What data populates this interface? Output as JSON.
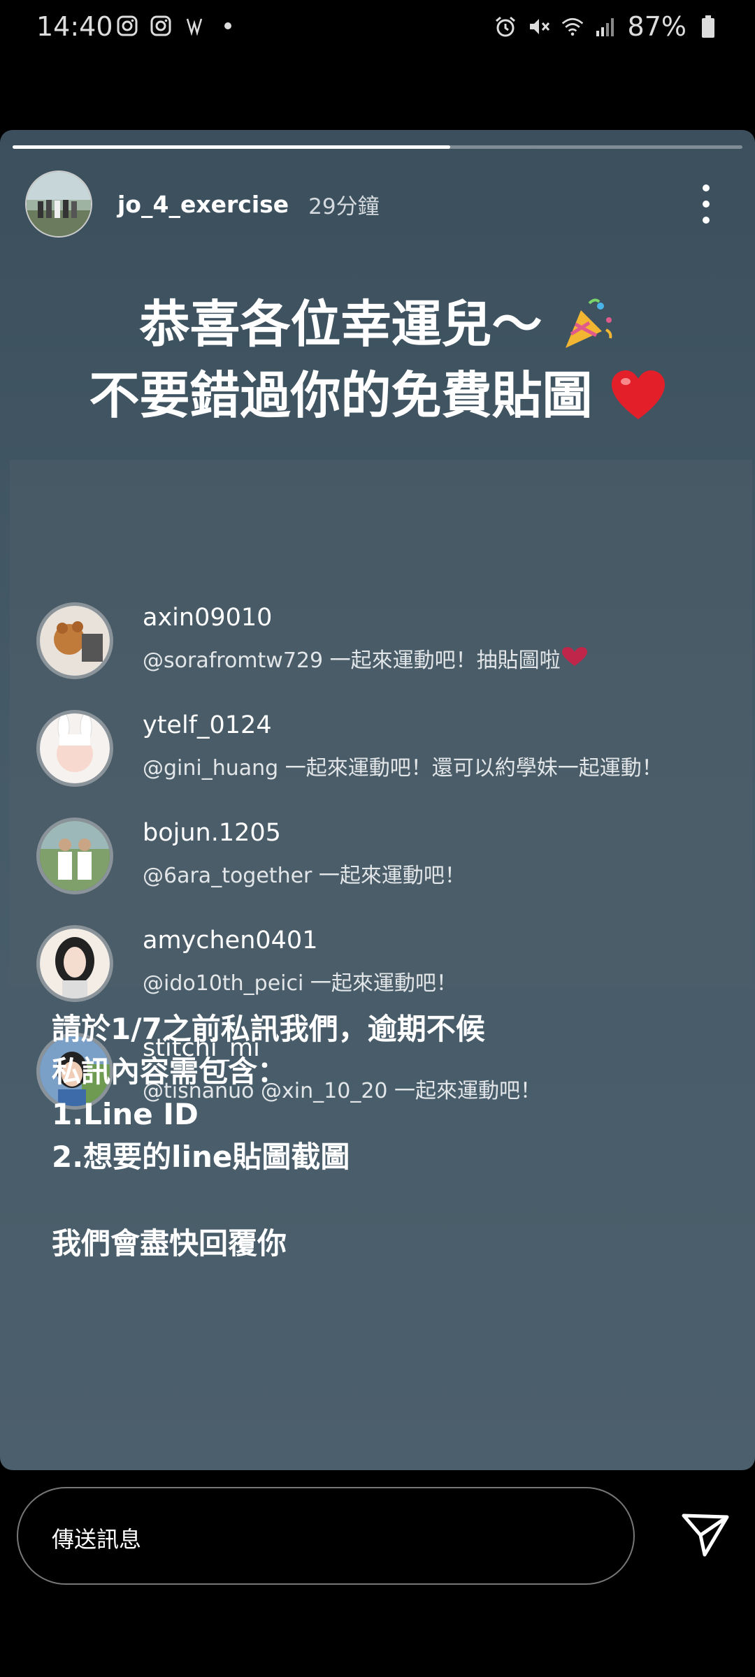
{
  "status_bar": {
    "time": "14:40",
    "left_icons": [
      "instagram-icon",
      "instagram-icon",
      "notification-app-icon",
      "dot-icon"
    ],
    "right_icons": [
      "alarm-icon",
      "mute-icon",
      "wifi-icon",
      "signal-icon"
    ],
    "battery": "87%"
  },
  "story": {
    "progress_fraction": 0.6,
    "username": "jo_4_exercise",
    "time_ago": "29分鐘",
    "headline_line1": "恭喜各位幸運兒～",
    "headline_line2": "不要錯過你的免費貼圖",
    "emoji_party": "party-popper-icon",
    "emoji_heart": "red-heart-icon",
    "winners": [
      {
        "username": "axin09010",
        "comment": "@sorafromtw729 一起來運動吧！抽貼圖啦"
      },
      {
        "username": "ytelf_0124",
        "comment": "@gini_huang 一起來運動吧！還可以約學妹一起運動！"
      },
      {
        "username": "bojun.1205",
        "comment": "@6ara_together 一起來運動吧！"
      },
      {
        "username": "amychen0401",
        "comment": "@ido10th_peici 一起來運動吧！"
      },
      {
        "username": "stitchi_mi",
        "comment": "@tisnanuo @xin_10_20 一起來運動吧！"
      }
    ],
    "instructions": [
      "請於1/7之前私訊我們，逾期不候",
      "私訊內容需包含：",
      "1.Line ID",
      "2.想要的line貼圖截圖",
      "我們會盡快回覆你"
    ]
  },
  "composer": {
    "placeholder": "傳送訊息",
    "send_icon": "send-icon"
  },
  "colors": {
    "story_bg": "#44596a",
    "avatar_border": "#8a929a"
  }
}
